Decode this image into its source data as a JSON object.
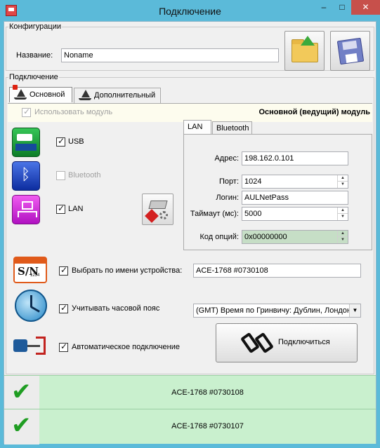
{
  "window": {
    "title": "Подключение",
    "minimize": "–",
    "maximize": "□",
    "close": "✕",
    "app_icon": "app-logo-icon"
  },
  "config": {
    "legend": "Конфигурации",
    "name_label": "Название:",
    "name_value": "Noname",
    "open_icon": "folder-open-icon",
    "save_icon": "floppy-save-icon"
  },
  "connection": {
    "legend": "Подключение",
    "tabs": [
      {
        "label": "Основной",
        "active": true
      },
      {
        "label": "Дополнительный",
        "active": false
      }
    ],
    "use_module_label": "Использовать модуль",
    "use_module_checked": true,
    "module_role": "Основной (ведущий) модуль",
    "interfaces": [
      {
        "label": "USB",
        "checked": true,
        "enabled": true,
        "icon": "usb-icon"
      },
      {
        "label": "Bluetooth",
        "checked": false,
        "enabled": false,
        "icon": "bluetooth-icon"
      },
      {
        "label": "LAN",
        "checked": true,
        "enabled": true,
        "icon": "lan-icon"
      }
    ],
    "device_settings_icon": "device-settings-icon",
    "subtabs": [
      {
        "label": "LAN",
        "active": true
      },
      {
        "label": "Bluetooth",
        "active": false
      }
    ],
    "lan": {
      "address_label": "Адрес:",
      "address_value": "198.162.0.101",
      "port_label": "Порт:",
      "port_value": "1024",
      "login_label": "Логин:",
      "login_value": "AULNetPass",
      "timeout_label": "Таймаут (мс):",
      "timeout_value": "5000",
      "options_label": "Код опций:",
      "options_value": "0x00000000"
    },
    "select_by_name_label": "Выбрать по имени устройства:",
    "select_by_name_checked": true,
    "device_name_value": "ACE-1768 #0730108",
    "sn_badge": "S/N",
    "sn_number": "1234",
    "timezone_label": "Учитывать часовой пояс",
    "timezone_checked": true,
    "timezone_value": "(GMT) Время по Гринвичу: Дублин, Лондон",
    "auto_connect_label": "Автоматическое подключение",
    "auto_connect_checked": true,
    "connect_button": "Подключиться"
  },
  "devices": [
    {
      "name": "ACE-1768 #0730108",
      "status_icon": "green-check-icon"
    },
    {
      "name": "ACE-1768 #0730107",
      "status_icon": "green-check-icon"
    }
  ]
}
